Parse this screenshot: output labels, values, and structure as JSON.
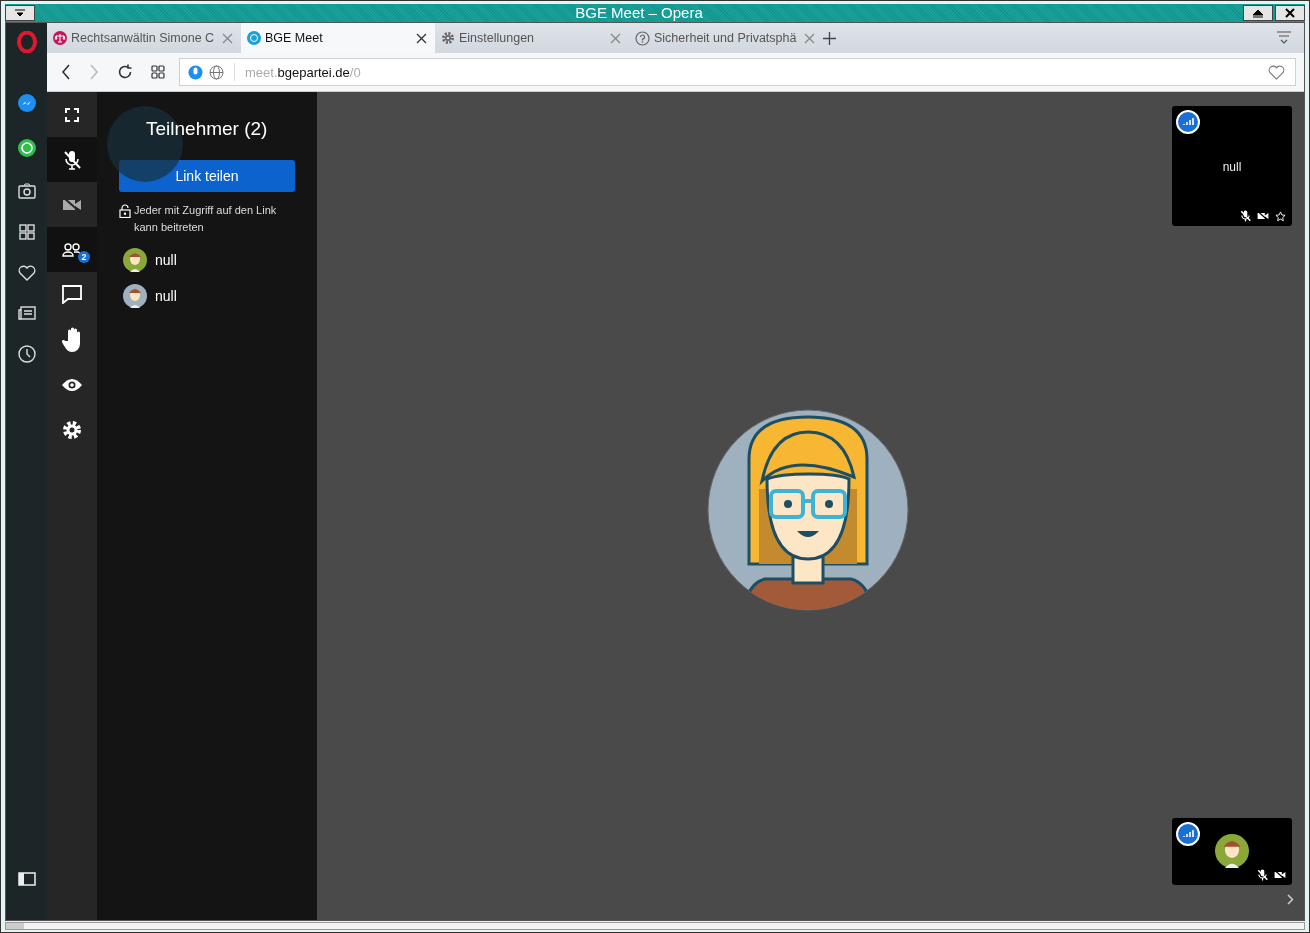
{
  "window": {
    "title": "BGE Meet – Opera"
  },
  "tabs": [
    {
      "label": "Rechtsanwältin Simone C",
      "kind": "scales",
      "selected": false
    },
    {
      "label": "BGE Meet",
      "kind": "logo",
      "selected": true
    },
    {
      "label": "Einstellungen",
      "kind": "gear",
      "selected": false
    },
    {
      "label": "Sicherheit und Privatsphä",
      "kind": "help",
      "selected": false
    }
  ],
  "address": {
    "prefix": "meet.",
    "domain": "bgepartei.de",
    "path": "/0"
  },
  "toolbar": [
    {
      "kind": "fullscreen",
      "selected": false
    },
    {
      "kind": "mic-muted",
      "selected": true
    },
    {
      "kind": "camera-off",
      "selected": false
    },
    {
      "kind": "participants",
      "selected": true,
      "badge": "2"
    },
    {
      "kind": "chat",
      "selected": false
    },
    {
      "kind": "hand",
      "selected": false
    },
    {
      "kind": "eye",
      "selected": false
    },
    {
      "kind": "settings",
      "selected": false
    }
  ],
  "panel": {
    "title": "Teilnehmer (2)",
    "share_button": "Link teilen",
    "note": "Jeder mit Zugriff auf den Link kann beitreten",
    "participants": [
      {
        "name": "null",
        "color": "#8aa83a"
      },
      {
        "name": "null",
        "color": "#9fb0be"
      }
    ]
  },
  "tiles": [
    {
      "kind": "remote",
      "label": "null"
    },
    {
      "kind": "local"
    }
  ]
}
